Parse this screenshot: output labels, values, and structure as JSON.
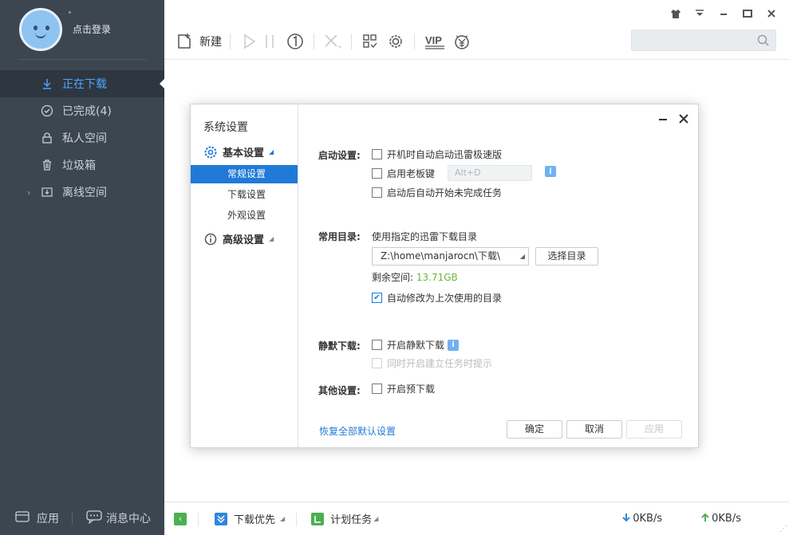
{
  "sidebar": {
    "login_label": "点击登录",
    "nav": [
      {
        "label": "正在下载",
        "icon": "download-icon"
      },
      {
        "label": "已完成(4)",
        "icon": "check-circle-icon"
      },
      {
        "label": "私人空间",
        "icon": "lock-icon"
      },
      {
        "label": "垃圾箱",
        "icon": "trash-icon"
      },
      {
        "label": "离线空间",
        "icon": "cloud-download-icon"
      }
    ],
    "bottom": {
      "apps_label": "应用",
      "messages_label": "消息中心"
    }
  },
  "toolbar": {
    "new_label": "新建",
    "vip_label": "VIP",
    "search_placeholder": ""
  },
  "statusbar": {
    "priority_label": "下载优先",
    "schedule_label": "计划任务",
    "down_speed": "0KB/s",
    "up_speed": "0KB/s"
  },
  "dialog": {
    "title": "系统设置",
    "groups": {
      "basic": "基本设置",
      "advanced": "高级设置"
    },
    "subs": [
      "常规设置",
      "下载设置",
      "外观设置"
    ],
    "startup": {
      "label": "启动设置:",
      "opt1": "开机时自动启动迅雷极速版",
      "opt2": "启用老板键",
      "hotkey": "Alt+D",
      "opt3": "启动后自动开始未完成任务"
    },
    "dir": {
      "label": "常用目录:",
      "desc": "使用指定的迅雷下载目录",
      "path": "Z:\\home\\manjarocn\\下载\\",
      "choose_btn": "选择目录",
      "free_label": "剩余空间:",
      "free_value": "13.71GB",
      "auto_label": "自动修改为上次使用的目录"
    },
    "silent": {
      "label": "静默下载:",
      "opt1": "开启静默下载",
      "opt2": "同时开启建立任务时提示"
    },
    "other": {
      "label": "其他设置:",
      "opt1": "开启预下载"
    },
    "restore_label": "恢复全部默认设置",
    "ok_btn": "确定",
    "cancel_btn": "取消",
    "apply_btn": "应用"
  }
}
